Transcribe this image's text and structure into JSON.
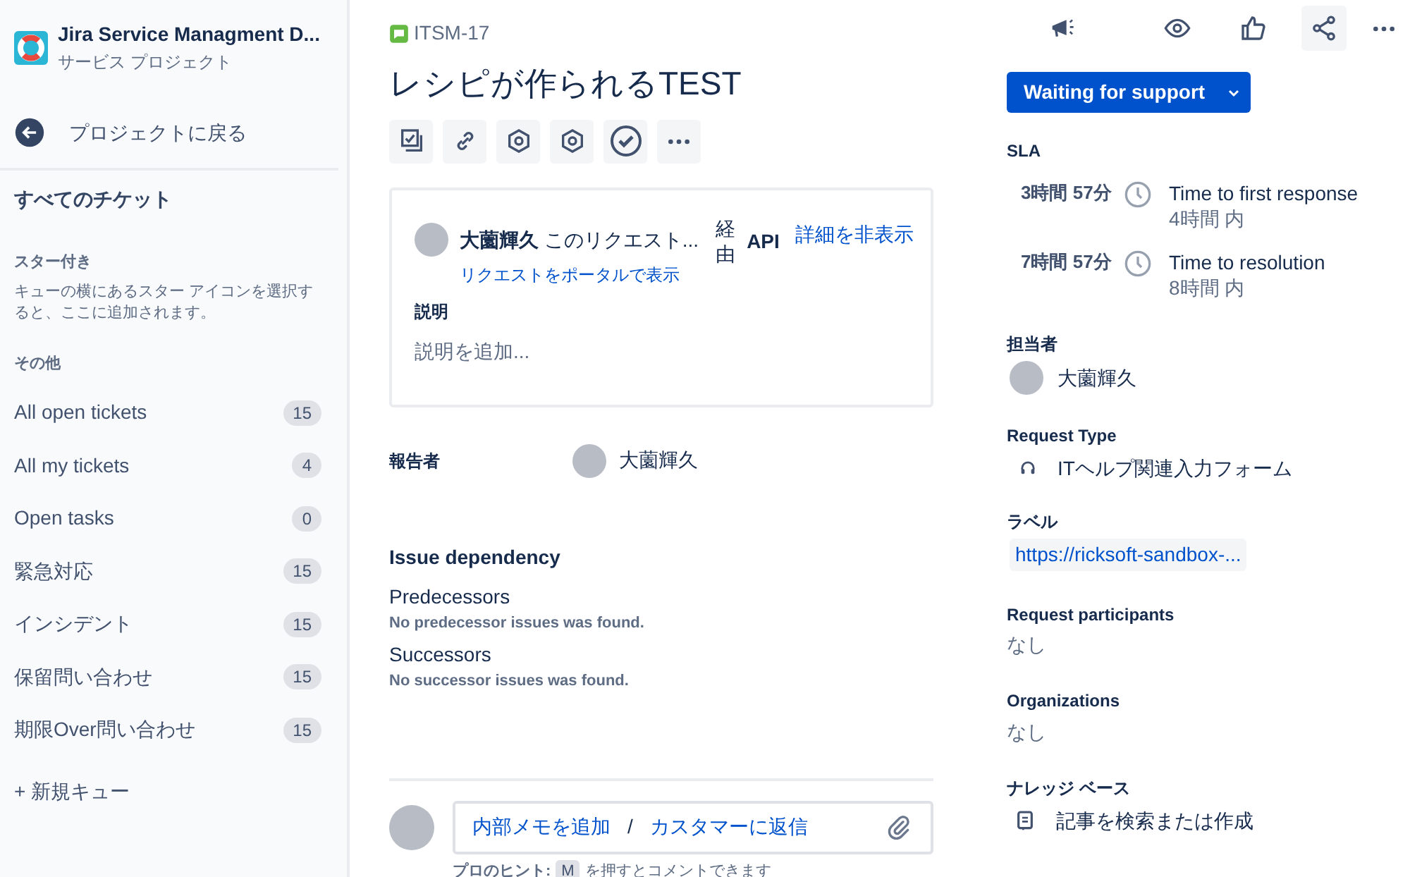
{
  "sidebar": {
    "project_name": "Jira Service Managment D...",
    "project_type": "サービス プロジェクト",
    "back_link": "プロジェクトに戻る",
    "all_tickets": "すべてのチケット",
    "starred": {
      "heading": "スター付き",
      "hint": "キューの横にあるスター アイコンを選択すると、ここに追加されます。"
    },
    "other": {
      "heading": "その他",
      "queues": [
        {
          "label": "All open tickets",
          "count": "15"
        },
        {
          "label": "All my tickets",
          "count": "4"
        },
        {
          "label": "Open tasks",
          "count": "0"
        },
        {
          "label": "緊急対応",
          "count": "15"
        },
        {
          "label": "インシデント",
          "count": "15"
        },
        {
          "label": "保留問い合わせ",
          "count": "15"
        },
        {
          "label": "期限Over問い合わせ",
          "count": "15"
        }
      ]
    },
    "new_queue": "+ 新規キュー"
  },
  "issue": {
    "key": "ITSM-17",
    "title": "レシピが作られるTEST",
    "request": {
      "author": "大薗輝久",
      "summary": "このリクエスト...",
      "via": "経由",
      "channel": "API",
      "hide_details": "詳細を非表示",
      "portal_link": "リクエストをポータルで表示",
      "description_label": "説明",
      "description_placeholder": "説明を追加..."
    },
    "reporter": {
      "label": "報告者",
      "name": "大薗輝久"
    },
    "dependency": {
      "heading": "Issue dependency",
      "sections": [
        {
          "title": "Predecessors",
          "empty": "No predecessor issues was found."
        },
        {
          "title": "Successors",
          "empty": "No successor issues was found."
        }
      ]
    },
    "comment": {
      "internal_note": "内部メモを追加",
      "separator": "/",
      "reply": "カスタマーに返信",
      "hint_label": "プロのヒント:",
      "hint_key": "M",
      "hint_text": "を押すとコメントできます"
    }
  },
  "details": {
    "status": "Waiting for support",
    "sla": {
      "heading": "SLA",
      "items": [
        {
          "remaining": "3時間 57分",
          "name": "Time to first response",
          "goal": "4時間 内"
        },
        {
          "remaining": "7時間 57分",
          "name": "Time to resolution",
          "goal": "8時間 内"
        }
      ]
    },
    "assignee": {
      "label": "担当者",
      "name": "大薗輝久"
    },
    "request_type": {
      "label": "Request Type",
      "value": "ITヘルプ関連入力フォーム"
    },
    "labels": {
      "label": "ラベル",
      "values": [
        "https://ricksoft-sandbox-..."
      ]
    },
    "participants": {
      "label": "Request participants",
      "value": "なし"
    },
    "organizations": {
      "label": "Organizations",
      "value": "なし"
    },
    "knowledge": {
      "label": "ナレッジ ベース",
      "value": "記事を検索または作成"
    }
  }
}
